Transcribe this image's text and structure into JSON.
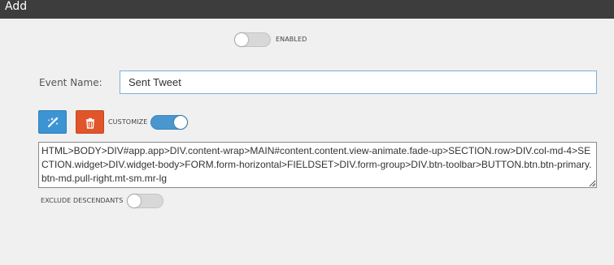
{
  "window": {
    "title": "Add"
  },
  "enabled_toggle": {
    "label": "ENABLED",
    "state": "off"
  },
  "event_name": {
    "label": "Event Name:",
    "value": "Sent Tweet"
  },
  "toolbar": {
    "pick_icon": "magic-wand-icon",
    "delete_icon": "trash-icon",
    "customize_label": "CUSTOMIZE",
    "customize_state": "on"
  },
  "selector": {
    "value": "HTML>BODY>DIV#app.app>DIV.content-wrap>MAIN#content.content.view-animate.fade-up>SECTION.row>DIV.col-md-4>SECTION.widget>DIV.widget-body>FORM.form-horizontal>FIELDSET>DIV.form-group>DIV.btn-toolbar>BUTTON.btn.btn-primary.btn-md.pull-right.mt-sm.mr-lg"
  },
  "exclude_descendants": {
    "label": "EXCLUDE DESCENDANTS",
    "state": "off"
  },
  "colors": {
    "accent": "#3d94d3",
    "danger": "#e0562a",
    "titlebar": "#3d3d3d"
  }
}
